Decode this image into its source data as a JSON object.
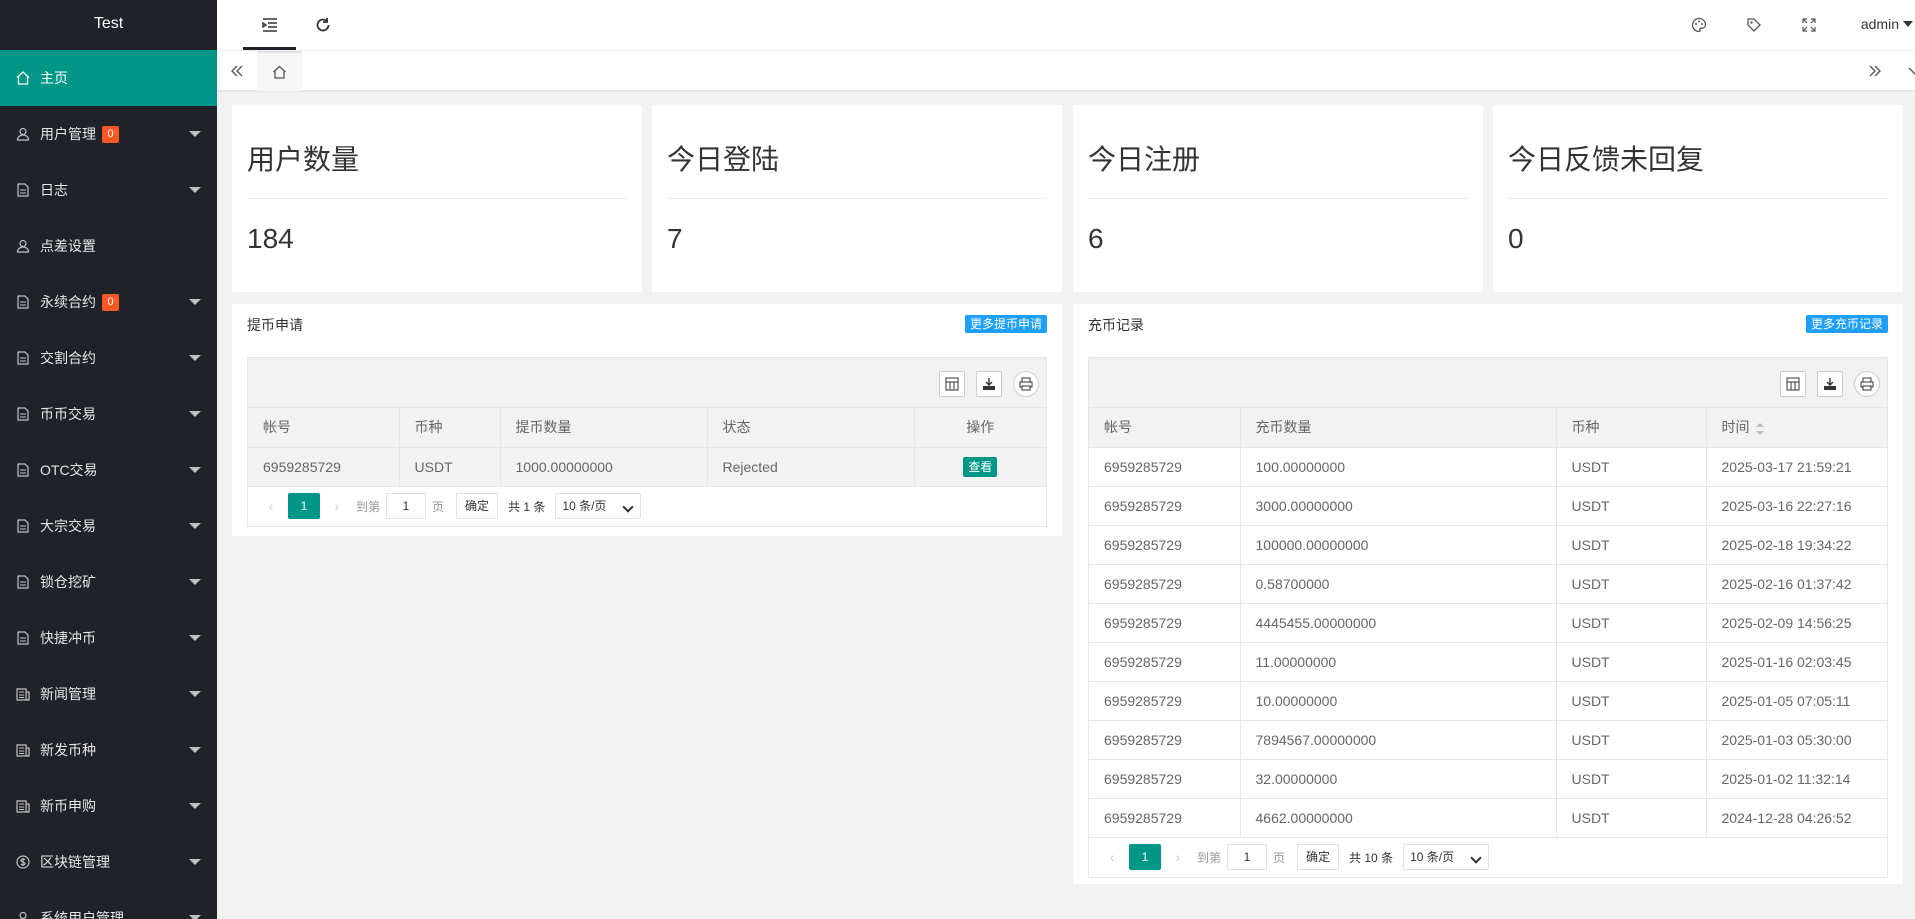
{
  "sidebar": {
    "logo": "Test",
    "items": [
      {
        "label": "主页",
        "icon": "home-icon"
      },
      {
        "label": "用户管理",
        "icon": "user-icon",
        "badge": "0"
      },
      {
        "label": "日志",
        "icon": "doc-icon"
      },
      {
        "label": "点差设置",
        "icon": "user-icon"
      },
      {
        "label": "永续合约",
        "icon": "doc-icon",
        "badge": "0"
      },
      {
        "label": "交割合约",
        "icon": "doc-icon"
      },
      {
        "label": "币币交易",
        "icon": "doc-icon"
      },
      {
        "label": "OTC交易",
        "icon": "doc-icon"
      },
      {
        "label": "大宗交易",
        "icon": "doc-icon"
      },
      {
        "label": "锁仓挖矿",
        "icon": "doc-icon"
      },
      {
        "label": "快捷冲币",
        "icon": "doc-icon"
      },
      {
        "label": "新闻管理",
        "icon": "news-icon"
      },
      {
        "label": "新发币种",
        "icon": "news-icon"
      },
      {
        "label": "新币申购",
        "icon": "news-icon"
      },
      {
        "label": "区块链管理",
        "icon": "dollar-icon"
      },
      {
        "label": "系统用户管理",
        "icon": "user-icon"
      }
    ]
  },
  "header": {
    "user": "admin"
  },
  "stats": [
    {
      "title": "用户数量",
      "value": "184"
    },
    {
      "title": "今日登陆",
      "value": "7"
    },
    {
      "title": "今日注册",
      "value": "6"
    },
    {
      "title": "今日反馈未回复",
      "value": "0"
    }
  ],
  "withdraw": {
    "title": "提币申请",
    "more": "更多提币申请",
    "columns": [
      "帐号",
      "币种",
      "提币数量",
      "状态",
      "操作"
    ],
    "rows": [
      {
        "account": "6959285729",
        "coin": "USDT",
        "amount": "1000.00000000",
        "status": "Rejected",
        "action": "查看"
      }
    ],
    "pager": {
      "page": "1",
      "goto": "到第",
      "input": "1",
      "unit": "页",
      "ok": "确定",
      "total": "共 1 条",
      "size": "10 条/页"
    }
  },
  "deposit": {
    "title": "充币记录",
    "more": "更多充币记录",
    "columns": [
      "帐号",
      "充币数量",
      "币种",
      "时间"
    ],
    "rows": [
      {
        "account": "6959285729",
        "amount": "100.00000000",
        "coin": "USDT",
        "time": "2025-03-17 21:59:21"
      },
      {
        "account": "6959285729",
        "amount": "3000.00000000",
        "coin": "USDT",
        "time": "2025-03-16 22:27:16"
      },
      {
        "account": "6959285729",
        "amount": "100000.00000000",
        "coin": "USDT",
        "time": "2025-02-18 19:34:22"
      },
      {
        "account": "6959285729",
        "amount": "0.58700000",
        "coin": "USDT",
        "time": "2025-02-16 01:37:42"
      },
      {
        "account": "6959285729",
        "amount": "4445455.00000000",
        "coin": "USDT",
        "time": "2025-02-09 14:56:25"
      },
      {
        "account": "6959285729",
        "amount": "11.00000000",
        "coin": "USDT",
        "time": "2025-01-16 02:03:45"
      },
      {
        "account": "6959285729",
        "amount": "10.00000000",
        "coin": "USDT",
        "time": "2025-01-05 07:05:11"
      },
      {
        "account": "6959285729",
        "amount": "7894567.00000000",
        "coin": "USDT",
        "time": "2025-01-03 05:30:00"
      },
      {
        "account": "6959285729",
        "amount": "32.00000000",
        "coin": "USDT",
        "time": "2025-01-02 11:32:14"
      },
      {
        "account": "6959285729",
        "amount": "4662.00000000",
        "coin": "USDT",
        "time": "2024-12-28 04:26:52"
      }
    ],
    "pager": {
      "page": "1",
      "goto": "到第",
      "input": "1",
      "unit": "页",
      "ok": "确定",
      "total": "共 10 条",
      "size": "10 条/页"
    }
  },
  "colors": {
    "sidebar": "#20222a",
    "accent": "#009688",
    "badge": "#ff5722",
    "link": "#1e9fff"
  }
}
